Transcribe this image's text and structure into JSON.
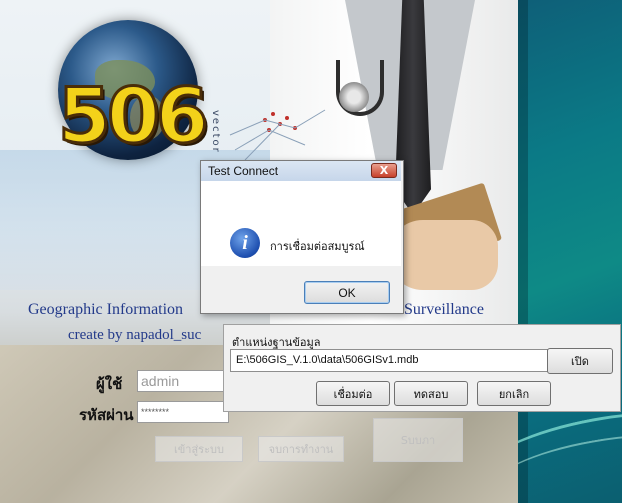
{
  "splash": {
    "logo_text": "506",
    "vector_text": "vector",
    "title_left": "Geographic  Information",
    "title_right": "Surveillance",
    "credit": "create by napadol_suc",
    "user_label": "ผู้ใช้",
    "password_label": "รหัสผ่าน",
    "user_value": "admin",
    "password_value": "********",
    "login_button": "เข้าสู่ระบบ",
    "exit_button": "จบการทำงาน",
    "shadow_button": "Sบบภา"
  },
  "message_box": {
    "title": "Test Connect",
    "close_label": "X",
    "info_icon_glyph": "i",
    "message": "การเชื่อมต่อสมบูรณ์",
    "ok_label": "OK"
  },
  "db_panel": {
    "label": "ตำแหน่งฐานข้อมูล",
    "path_value": "E:\\506GIS_V.1.0\\data\\506GISv1.mdb",
    "open_button": "เปิด",
    "connect_button": "เชื่อมต่อ",
    "test_button": "ทดสอบ",
    "cancel_button": "ยกเลิก"
  },
  "colors": {
    "title_text": "#233a8a",
    "logo_fill": "#f3d21a",
    "vista_teal": "#0b7a86",
    "dialog_bg": "#f0f0f0",
    "close_red": "#c7402a",
    "info_blue": "#1d4eaf"
  },
  "icons": {
    "info": "info-icon",
    "close": "close-icon"
  }
}
